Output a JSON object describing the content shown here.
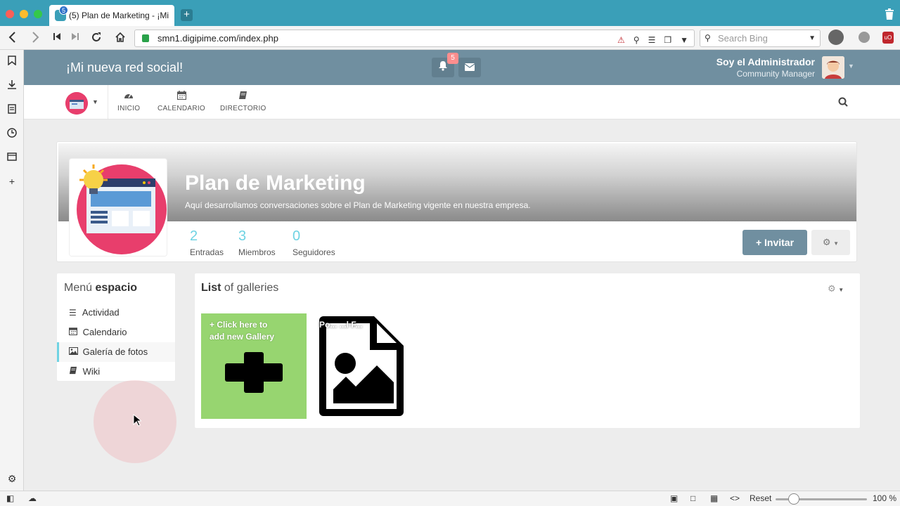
{
  "browser": {
    "tab_title": "(5) Plan de Marketing - ¡Mi",
    "tab_badge": "5",
    "url": "smn1.digipime.com/index.php",
    "search_placeholder": "Search Bing",
    "zoom_reset_label": "Reset",
    "zoom_level": "100 %",
    "zoom_fraction": 0.2
  },
  "header": {
    "site_title": "¡Mi nueva red social!",
    "notification_count": "5",
    "user_name": "Soy el Administrador",
    "user_role": "Community Manager"
  },
  "nav": {
    "items": [
      {
        "label": "INICIO",
        "icon": "dashboard-icon"
      },
      {
        "label": "CALENDARIO",
        "icon": "calendar-icon"
      },
      {
        "label": "DIRECTORIO",
        "icon": "book-icon"
      }
    ]
  },
  "space": {
    "title": "Plan de Marketing",
    "description": "Aquí desarrollamos conversaciones sobre el Plan de Marketing vigente en nuestra empresa.",
    "stats": [
      {
        "value": "2",
        "label": "Entradas"
      },
      {
        "value": "3",
        "label": "Miembros"
      },
      {
        "value": "0",
        "label": "Seguidores"
      }
    ],
    "invite_label": "Invitar"
  },
  "menu": {
    "title_prefix": "Menú",
    "title_bold": "espacio",
    "items": [
      {
        "label": "Actividad",
        "icon": "list-icon",
        "active": false
      },
      {
        "label": "Calendario",
        "icon": "calendar-icon",
        "active": false
      },
      {
        "label": "Galería de fotos",
        "icon": "image-icon",
        "active": true
      },
      {
        "label": "Wiki",
        "icon": "book-icon",
        "active": false
      }
    ]
  },
  "gallery": {
    "title_bold": "List",
    "title_rest": "of galleries",
    "add_tile_line1": "+ Click here to",
    "add_tile_line2": "add new Gallery",
    "photo_tile_label": "Po... ...l F..."
  },
  "colors": {
    "header_bg": "#708fa0",
    "accent": "#6fd3e3",
    "add_tile": "#97d570",
    "browser_chrome": "#3a9fb8"
  }
}
